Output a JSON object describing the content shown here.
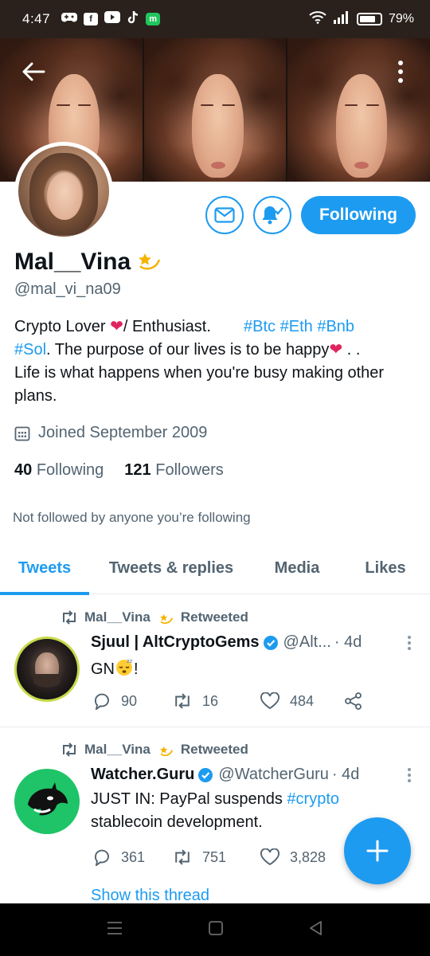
{
  "status_bar": {
    "time": "4:47",
    "apps": [
      "game-controller-icon",
      "facebook-icon",
      "youtube-icon",
      "tiktok-icon",
      "m-app-icon"
    ],
    "m_app_label": "m",
    "facebook_label": "f",
    "battery": "79%",
    "battery_level": 0.79
  },
  "profile": {
    "name": "Mal__Vina",
    "handle": "@mal_vi_na09",
    "bio": {
      "line1_a": "Crypto Lover ",
      "line1_b": "/ Enthusiast.",
      "tags_line1": [
        "#Btc",
        "#Eth",
        "#Bnb"
      ],
      "tag_line2": "#Sol",
      "line2_rest": ".  The purpose of our lives is to be happy",
      "line2_end": " . .",
      "line3": "Life is what happens when you're busy making other plans."
    },
    "joined": "Joined September 2009",
    "following_count": "40",
    "following_label": "Following",
    "followers_count": "121",
    "followers_label": "Followers",
    "not_followed": "Not followed by anyone you’re following",
    "follow_button": "Following"
  },
  "tabs": [
    {
      "label": "Tweets",
      "active": true
    },
    {
      "label": "Tweets & replies",
      "active": false
    },
    {
      "label": "Media",
      "active": false
    },
    {
      "label": "Likes",
      "active": false
    }
  ],
  "tweets": [
    {
      "retweeted_by": "Mal__Vina",
      "retweeted_label": "Retweeted",
      "author": "Sjuul | AltCryptoGems",
      "handle": "@Alt...",
      "time": "· 4d",
      "text": "GN",
      "text_end": "!",
      "replies": "90",
      "retweets": "16",
      "likes": "484"
    },
    {
      "retweeted_by": "Mal__Vina",
      "retweeted_label": "Retweeted",
      "author": "Watcher.Guru",
      "handle": "@WatcherGuru",
      "time": "· 4d",
      "text_a": "JUST IN: PayPal suspends ",
      "text_tag": "#crypto",
      "text_b": "stablecoin development.",
      "replies": "361",
      "retweets": "751",
      "likes": "3,828",
      "thread_link": "Show this thread"
    }
  ],
  "colors": {
    "accent": "#1d9bf0",
    "text_primary": "#0f1419",
    "text_secondary": "#536471"
  }
}
